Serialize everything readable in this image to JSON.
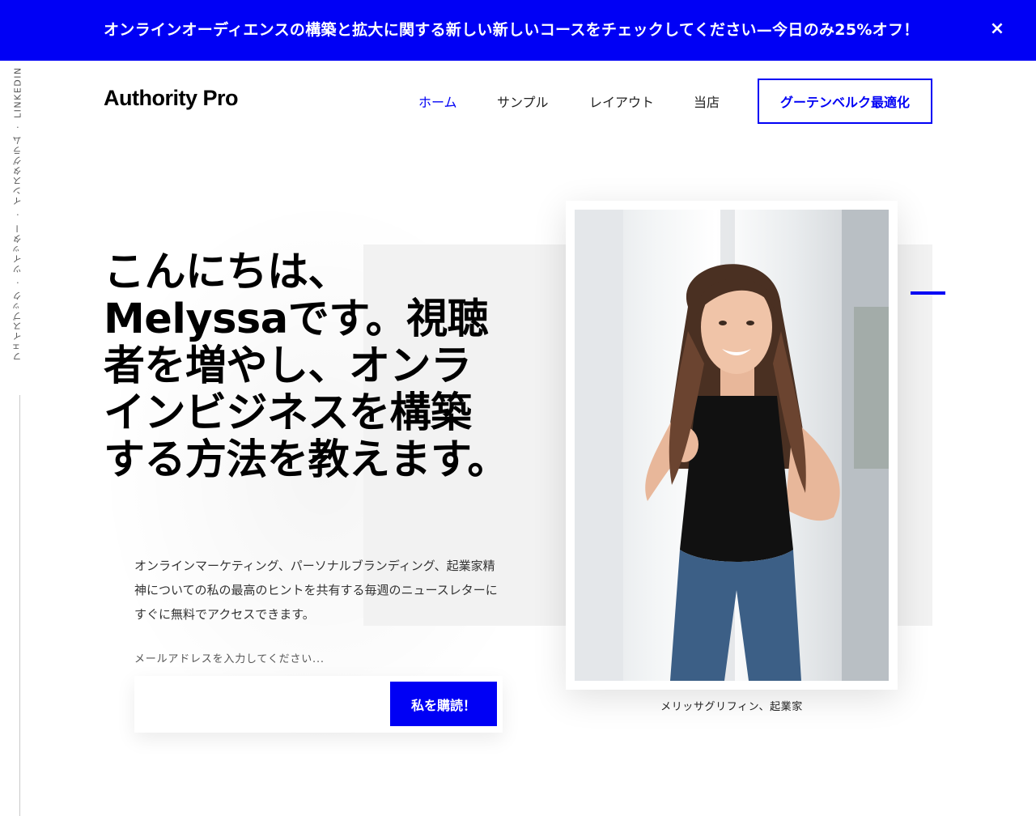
{
  "announcement": {
    "text": "オンラインオーディエンスの構築と拡大に関する新しい新しいコースをチェックしてください—今日のみ25%オフ！",
    "close_label": "×"
  },
  "social": {
    "items": [
      "フェイスブック",
      "ツイッター",
      "インスタグラム",
      "LINKEDIN"
    ],
    "separator": "·"
  },
  "header": {
    "logo": "Authority Pro",
    "nav": [
      {
        "label": "ホーム",
        "active": true
      },
      {
        "label": "サンプル",
        "active": false
      },
      {
        "label": "レイアウト",
        "active": false
      },
      {
        "label": "当店",
        "active": false
      }
    ],
    "cta_label": "グーテンベルク最適化"
  },
  "hero": {
    "headline": "こんにちは、Melyssaです。視聴者を増やし、オンラインビジネスを構築する方法を教えます。",
    "intro": "オンラインマーケティング、パーソナルブランディング、起業家精神についての私の最高のヒントを共有する毎週のニュースレターにすぐに無料でアクセスできます。",
    "email_label": "メールアドレスを入力してください...",
    "email_value": "",
    "subscribe_label": "私を購読！"
  },
  "photo": {
    "caption": "メリッサグリフィン、起業家"
  },
  "colors": {
    "accent": "#0000f5",
    "panel": "#f2f2f2"
  }
}
